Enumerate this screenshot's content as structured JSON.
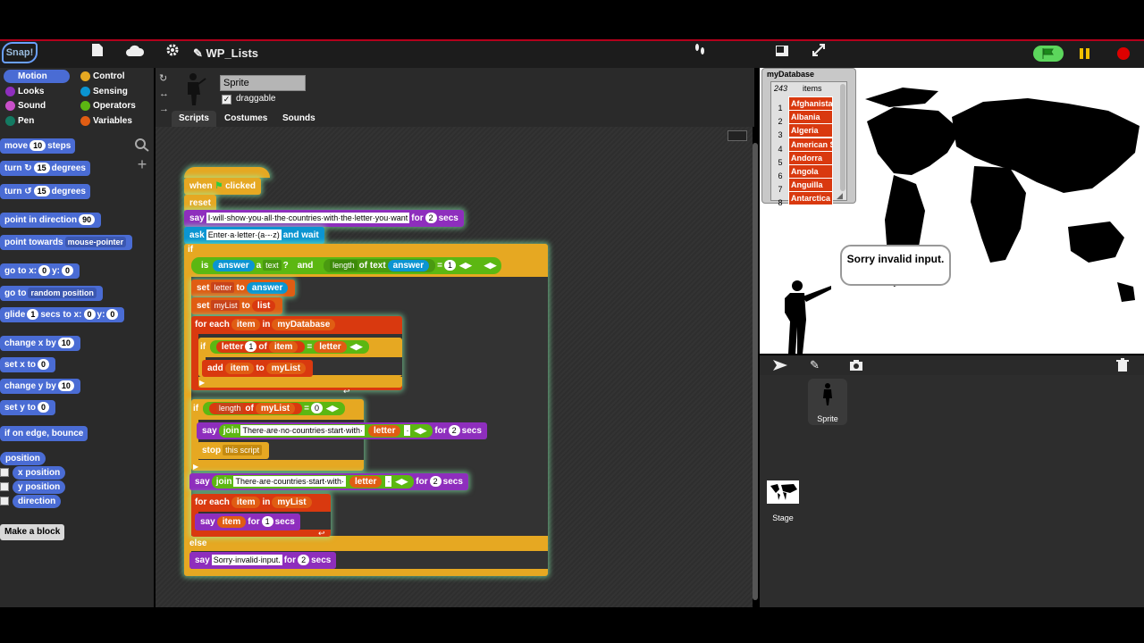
{
  "app": {
    "logo": "Snap!",
    "project_title": "WP_Lists",
    "icons": [
      "file-icon",
      "cloud-icon",
      "gear-icon",
      "pencil-icon",
      "footprints-icon",
      "stage-size-icon",
      "fullscreen-icon",
      "green-flag-icon",
      "pause-icon",
      "stop-icon"
    ]
  },
  "palette": {
    "categories": [
      "Motion",
      "Looks",
      "Sound",
      "Pen",
      "Control",
      "Sensing",
      "Operators",
      "Variables"
    ],
    "selected": "Motion",
    "blocks": {
      "move": {
        "label1": "move",
        "value": "10",
        "label2": "steps"
      },
      "turn_cw": {
        "label1": "turn",
        "value": "15",
        "label2": "degrees"
      },
      "turn_ccw": {
        "label1": "turn",
        "value": "15",
        "label2": "degrees"
      },
      "point_dir": {
        "label1": "point in direction",
        "value": "90"
      },
      "point_towards": {
        "label1": "point towards",
        "value": "mouse-pointer"
      },
      "goto_xy": {
        "label1": "go to x:",
        "x": "0",
        "label2": "y:",
        "y": "0"
      },
      "goto": {
        "label1": "go to",
        "value": "random position"
      },
      "glide": {
        "label1": "glide",
        "secs": "1",
        "label2": "secs to x:",
        "x": "0",
        "label3": "y:",
        "y": "0"
      },
      "change_x": {
        "label1": "change x by",
        "value": "10"
      },
      "set_x": {
        "label1": "set x to",
        "value": "0"
      },
      "change_y": {
        "label1": "change y by",
        "value": "10"
      },
      "set_y": {
        "label1": "set y to",
        "value": "0"
      },
      "bounce": {
        "label1": "if on edge, bounce"
      },
      "position": "position",
      "x_position": "x position",
      "y_position": "y position",
      "direction": "direction"
    },
    "make_block": "Make a block"
  },
  "sprite": {
    "name": "Sprite",
    "draggable_label": "draggable",
    "tabs": [
      "Scripts",
      "Costumes",
      "Sounds"
    ]
  },
  "script": {
    "hat": {
      "when": "when",
      "clicked": "clicked"
    },
    "reset": "reset",
    "say1": {
      "say": "say",
      "text": "I·will·show·you·all·the·countries·with·the·letter·you·want",
      "for": "for",
      "secs_val": "2",
      "secs": "secs"
    },
    "ask": {
      "ask": "ask",
      "text": "Enter·a·letter·(a·-·z)",
      "wait": "and wait"
    },
    "if1": {
      "if": "if",
      "is": "is",
      "answer": "answer",
      "a": "a",
      "type": "text",
      "q": "?",
      "and": "and",
      "length": "length",
      "of_text": "of text",
      "answer2": "answer",
      "eq": "=",
      "one": "1"
    },
    "set_letter": {
      "set": "set",
      "var": "letter",
      "to": "to",
      "val": "answer"
    },
    "set_mylist": {
      "set": "set",
      "var": "myList",
      "to": "to",
      "val": "list"
    },
    "foreach1": {
      "for_each": "for each",
      "item": "item",
      "in": "in",
      "list": "myDatabase"
    },
    "if2": {
      "if": "if",
      "letter": "letter",
      "idx": "1",
      "of": "of",
      "item": "item",
      "eq": "=",
      "letter2": "letter"
    },
    "add": {
      "add": "add",
      "item": "item",
      "to": "to",
      "list": "myList"
    },
    "if3": {
      "if": "if",
      "length": "length",
      "of": "of",
      "list": "myList",
      "eq": "=",
      "zero": "0"
    },
    "say2": {
      "say": "say",
      "join": "join",
      "text": "There·are·no·countries·start·with·",
      "letter": "letter",
      "for": "for",
      "secs_val": "2",
      "secs": "secs"
    },
    "stop": {
      "stop": "stop",
      "val": "this script"
    },
    "say3": {
      "say": "say",
      "join": "join",
      "text": "There·are·countries·start·with·",
      "letter": "letter",
      "for": "for",
      "secs_val": "2",
      "secs": "secs"
    },
    "foreach2": {
      "for_each": "for each",
      "item": "item",
      "in": "in",
      "list": "myList"
    },
    "say4": {
      "say": "say",
      "item": "item",
      "for": "for",
      "secs_val": "1",
      "secs": "secs"
    },
    "else": "else",
    "say5": {
      "say": "say",
      "text": "Sorry·invalid·input.",
      "for": "for",
      "secs_val": "2",
      "secs": "secs"
    }
  },
  "stage": {
    "watcher": {
      "title": "myDatabase",
      "count": "243",
      "items_label": "items",
      "rows": [
        {
          "i": "1",
          "v": "Afghanistan"
        },
        {
          "i": "2",
          "v": "Albania"
        },
        {
          "i": "3",
          "v": "Algeria"
        },
        {
          "i": "4",
          "v": "American Samoa"
        },
        {
          "i": "5",
          "v": "Andorra"
        },
        {
          "i": "6",
          "v": "Angola"
        },
        {
          "i": "7",
          "v": "Anguilla"
        },
        {
          "i": "8",
          "v": "Antarctica"
        }
      ]
    },
    "bubble": "Sorry invalid input."
  },
  "corral": {
    "sprite_label": "Sprite",
    "stage_label": "Stage"
  },
  "colors": {
    "motion": "#4a6cd4",
    "control": "#e6a822",
    "looks": "#8e2ebd",
    "sensing": "#0b95d2",
    "operators": "#5cb712",
    "variables": "#e05d13",
    "lists": "#d9390f"
  }
}
